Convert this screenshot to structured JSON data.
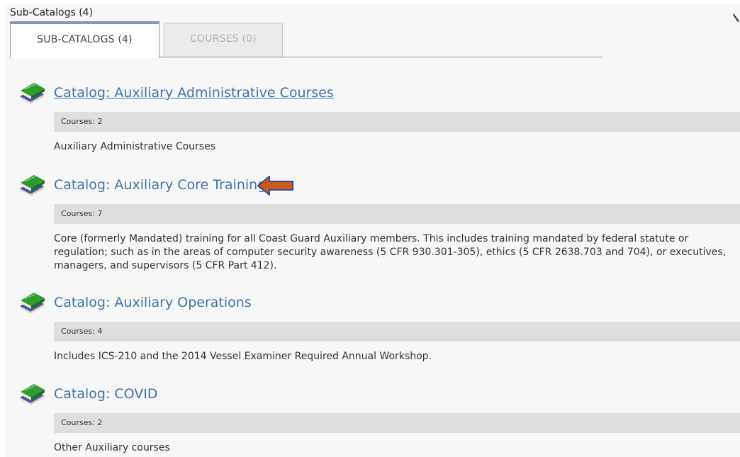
{
  "header": {
    "section_title": "Sub-Catalogs (4)"
  },
  "tabs": [
    {
      "label": "SUB-CATALOGS (4)",
      "active": true
    },
    {
      "label": "COURSES (0)",
      "active": false
    }
  ],
  "catalogs": [
    {
      "title": "Catalog: Auxiliary Administrative Courses",
      "courses": "Courses: 2",
      "description": "Auxiliary Administrative Courses",
      "hovered": true
    },
    {
      "title": "Catalog: Auxiliary Core Training",
      "courses": "Courses: 7",
      "description": "Core (formerly Mandated) training for all Coast Guard Auxiliary members. This includes training mandated by federal statute or regulation; such as in the areas of computer security awareness (5 CFR 930.301-305), ethics (5 CFR 2638.703 and 704), or executives, managers, and supervisors (5 CFR Part 412).",
      "annotated": true
    },
    {
      "title": "Catalog: Auxiliary Operations",
      "courses": "Courses: 4",
      "description": "Includes ICS-210 and the 2014 Vessel Examiner Required Annual Workshop."
    },
    {
      "title": "Catalog: COVID",
      "courses": "Courses: 2",
      "description": "Other Auxiliary courses"
    }
  ],
  "icons": {
    "catalog": "book-stack-icon",
    "annotation": "arrow-left-icon",
    "edit": "pencil-icon"
  },
  "colors": {
    "link": "#3f73a6",
    "tab_accent": "#7f98b3",
    "courses_bar": "#dedede",
    "arrow_fill": "#cc5a1e",
    "arrow_stroke": "#2f4f8f"
  }
}
